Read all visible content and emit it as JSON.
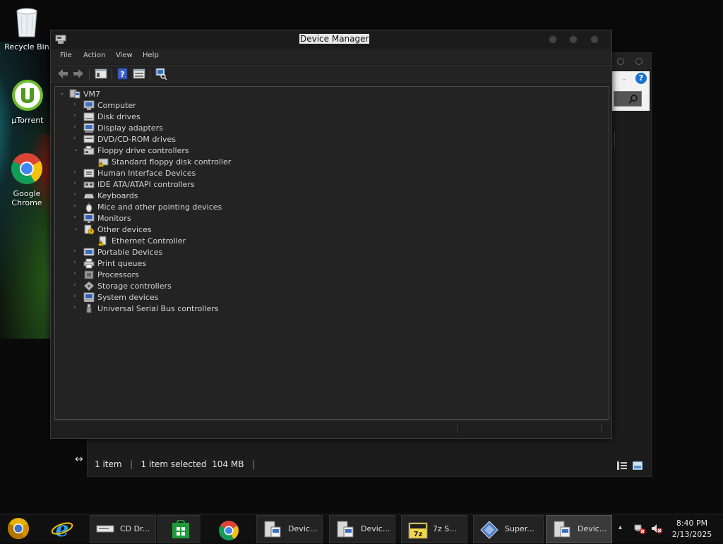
{
  "desktop": {
    "icons": [
      {
        "label": "Recycle Bin",
        "icon": "recycle-bin-icon"
      },
      {
        "label": "µTorrent",
        "icon": "utorrent-icon"
      },
      {
        "label": "Google Chrome",
        "icon": "chrome-icon"
      }
    ]
  },
  "background_window": {
    "status": {
      "item_count": "1 item",
      "selection": "1 item selected",
      "size": "104 MB"
    }
  },
  "device_manager": {
    "title": "Device Manager",
    "menu": [
      "File",
      "Action",
      "View",
      "Help"
    ],
    "toolbar": [
      "back-icon",
      "forward-icon",
      "properties-icon",
      "help-icon",
      "show-hidden-icon",
      "scan-hardware-icon"
    ],
    "tree": {
      "root": "VM7",
      "nodes": [
        {
          "label": "Computer",
          "expanded": false,
          "icon": "computer-icon"
        },
        {
          "label": "Disk drives",
          "expanded": false,
          "icon": "disk-drive-icon"
        },
        {
          "label": "Display adapters",
          "expanded": false,
          "icon": "display-adapter-icon"
        },
        {
          "label": "DVD/CD-ROM drives",
          "expanded": false,
          "icon": "dvd-drive-icon"
        },
        {
          "label": "Floppy drive controllers",
          "expanded": true,
          "icon": "floppy-controller-icon",
          "children": [
            {
              "label": "Standard floppy disk controller",
              "icon": "warning-device-icon"
            }
          ]
        },
        {
          "label": "Human Interface Devices",
          "expanded": false,
          "icon": "hid-icon"
        },
        {
          "label": "IDE ATA/ATAPI controllers",
          "expanded": false,
          "icon": "ide-controller-icon"
        },
        {
          "label": "Keyboards",
          "expanded": false,
          "icon": "keyboard-icon"
        },
        {
          "label": "Mice and other pointing devices",
          "expanded": false,
          "icon": "mouse-icon"
        },
        {
          "label": "Monitors",
          "expanded": false,
          "icon": "monitor-icon"
        },
        {
          "label": "Other devices",
          "expanded": true,
          "icon": "unknown-device-icon",
          "children": [
            {
              "label": "Ethernet Controller",
              "icon": "warning-device-icon"
            }
          ]
        },
        {
          "label": "Portable Devices",
          "expanded": false,
          "icon": "portable-device-icon"
        },
        {
          "label": "Print queues",
          "expanded": false,
          "icon": "printer-icon"
        },
        {
          "label": "Processors",
          "expanded": false,
          "icon": "processor-icon"
        },
        {
          "label": "Storage controllers",
          "expanded": false,
          "icon": "storage-controller-icon"
        },
        {
          "label": "System devices",
          "expanded": false,
          "icon": "system-device-icon"
        },
        {
          "label": "Universal Serial Bus controllers",
          "expanded": false,
          "icon": "usb-icon"
        }
      ]
    }
  },
  "taskbar": {
    "pinned": [
      "chrome-canary-icon",
      "internet-explorer-icon"
    ],
    "buttons": [
      {
        "label": "CD Dr...",
        "icon": "cd-drive-icon"
      },
      {
        "label": "",
        "icon": "store-icon"
      },
      {
        "label": "",
        "icon": "chrome-icon"
      },
      {
        "label": "Devic...",
        "icon": "device-manager-icon"
      },
      {
        "label": "Devic...",
        "icon": "device-manager-icon"
      },
      {
        "label": "7z S...",
        "icon": "7zip-icon"
      },
      {
        "label": "Super...",
        "icon": "superantispyware-icon"
      },
      {
        "label": "Devic...",
        "icon": "device-manager-icon"
      }
    ],
    "tray": {
      "time": "8:40 PM",
      "date": "2/13/2025"
    }
  },
  "colors": {
    "desktop_bg": "#0a0a0a",
    "window_bg": "#1e1e1e",
    "tree_bg": "#232323",
    "text": "#d4d4d4"
  }
}
